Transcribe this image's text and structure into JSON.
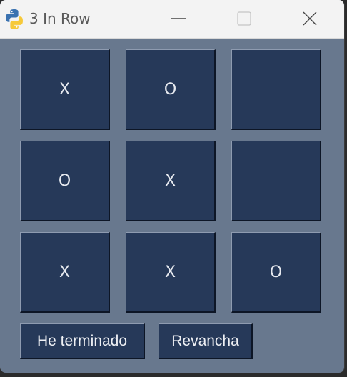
{
  "window": {
    "title": "3 In Row",
    "app_icon": "python-icon",
    "controls": {
      "minimize_icon": "minimize-icon",
      "maximize_icon": "maximize-icon",
      "close_icon": "close-icon"
    }
  },
  "board": {
    "cells": [
      [
        "X",
        "O",
        ""
      ],
      [
        "O",
        "X",
        ""
      ],
      [
        "X",
        "X",
        "O"
      ]
    ]
  },
  "buttons": {
    "finished_label": "He terminado",
    "rematch_label": "Revancha"
  },
  "colors": {
    "window_bg": "#68788e",
    "cell_bg": "#263959",
    "text": "#e6e9ef"
  }
}
